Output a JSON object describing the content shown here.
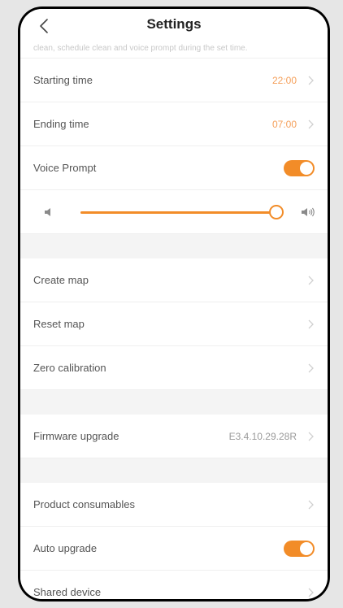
{
  "header": {
    "title": "Settings"
  },
  "dnd_note": "clean, schedule clean and voice prompt during the set time.",
  "schedule": {
    "start": {
      "label": "Starting time",
      "value": "22:00"
    },
    "end": {
      "label": "Ending time",
      "value": "07:00"
    }
  },
  "voice": {
    "label": "Voice Prompt",
    "enabled": true,
    "volume_fraction": 0.97
  },
  "map": {
    "create_label": "Create map",
    "reset_label": "Reset map",
    "zero_label": "Zero calibration"
  },
  "firmware": {
    "label": "Firmware upgrade",
    "version": "E3.4.10.29.28R"
  },
  "misc": {
    "consumables_label": "Product consumables",
    "auto_upgrade_label": "Auto upgrade",
    "auto_upgrade_enabled": true,
    "shared_label": "Shared device"
  },
  "colors": {
    "accent": "#f28c28",
    "value_orange": "#f5a05b",
    "background": "#f4f4f4"
  },
  "icons": {
    "back": "chevron-left-icon",
    "row_arrow": "chevron-right-icon",
    "volume_low": "volume-low-icon",
    "volume_high": "volume-high-icon"
  }
}
